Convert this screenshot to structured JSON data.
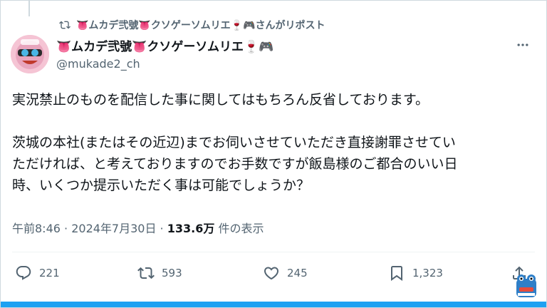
{
  "repost": {
    "prefix": "👅ムカデ弐號👅クソゲーソムリエ🍷🎮",
    "suffix": "さんがリポスト"
  },
  "author": {
    "display_name": "👅ムカデ弐號👅クソゲーソムリエ🍷🎮",
    "handle": "@mukade2_ch"
  },
  "post": {
    "paragraphs": [
      "実況禁止のものを配信した事に関してはもちろん反省しております。",
      "茨城の本社(またはその近辺)までお伺いさせていただき直接謝罪させてい",
      "ただければ、と考えておりますのでお手数ですが飯島様のご都合のいい日",
      "時、いくつか提示いただく事は可能でしょうか？"
    ]
  },
  "meta": {
    "time": "午前8:46",
    "sep1": " · ",
    "date": "2024年7月30日",
    "sep2": " · ",
    "views": "133.6万",
    "views_label": " 件の表示"
  },
  "actions": {
    "replies": "221",
    "reposts": "593",
    "likes": "245",
    "bookmarks": "1,323"
  },
  "colors": {
    "accent": "#1da1f2",
    "muted": "#536471",
    "text": "#0f1419"
  }
}
